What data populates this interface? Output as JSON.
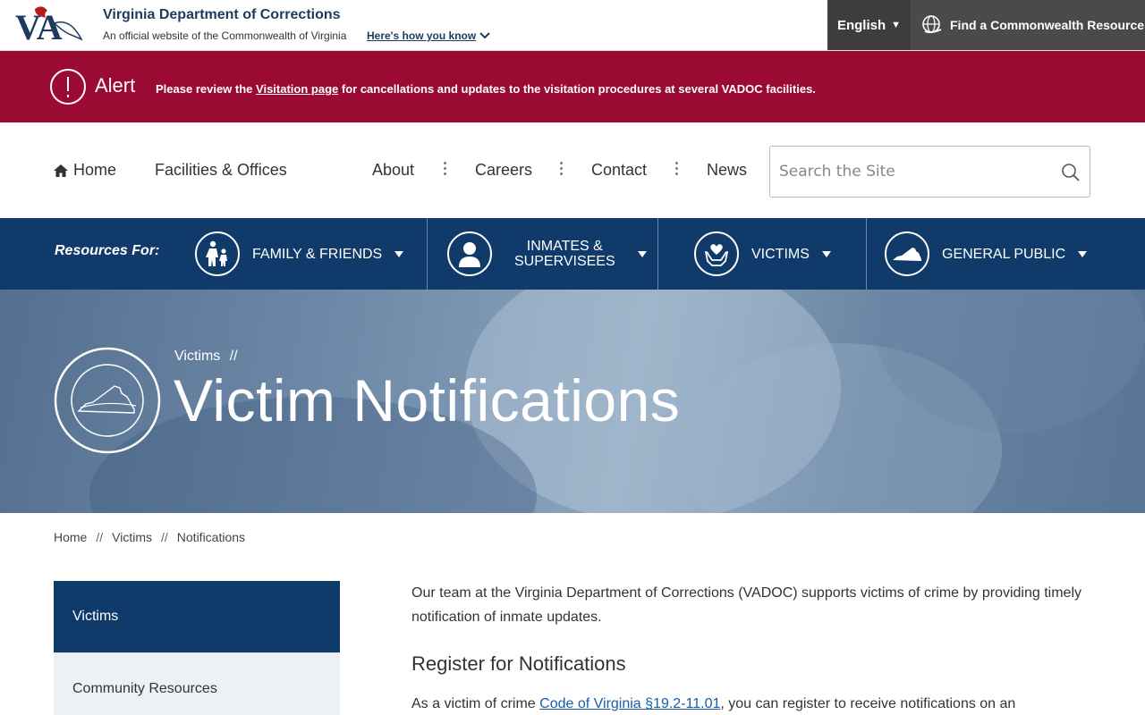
{
  "topbar": {
    "agency": "Virginia Department of Corrections",
    "official": "An official website of the Commonwealth of Virginia",
    "how_know": "Here's how you know",
    "language": "English",
    "find_resource": "Find a Commonwealth Resource"
  },
  "alert": {
    "label": "Alert",
    "text_before": "Please review the",
    "link": "Visitation page",
    "text_after": "for cancellations and updates to the visitation procedures at several VADOC facilities."
  },
  "nav": {
    "home": "Home",
    "facilities": "Facilities & Offices",
    "about": "About",
    "careers": "Careers",
    "contact": "Contact",
    "news": "News",
    "search_placeholder": "Search the Site"
  },
  "resources": {
    "label": "Resources For:",
    "items": [
      {
        "label": "Family & Friends",
        "icon": "family-icon"
      },
      {
        "label_line1": "Inmates &",
        "label_line2": "Supervisees",
        "icon": "person-icon"
      },
      {
        "label": "Victims",
        "icon": "heart-hands-icon"
      },
      {
        "label": "General Public",
        "icon": "virginia-map-icon"
      }
    ]
  },
  "hero": {
    "crumb": "Victims",
    "crumb_sep": "//",
    "title": "Victim Notifications"
  },
  "breadcrumb": [
    "Home",
    "Victims",
    "Notifications"
  ],
  "breadcrumb_sep": "//",
  "sidebar": {
    "active": "Victims",
    "items": [
      "Community Resources"
    ]
  },
  "content": {
    "intro": "Our team at the Virginia Department of Corrections (VADOC) supports victims of crime by providing timely notification of inmate updates.",
    "heading": "Register for Notifications",
    "para_before": "As a victim of crime",
    "para_link": "Code of Virginia §19.2-11.01",
    "para_after": ", you can register to receive notifications on an"
  },
  "colors": {
    "navy": "#0f3a6a",
    "alert_red": "#9b0a32",
    "link_blue": "#1a5ea8"
  }
}
